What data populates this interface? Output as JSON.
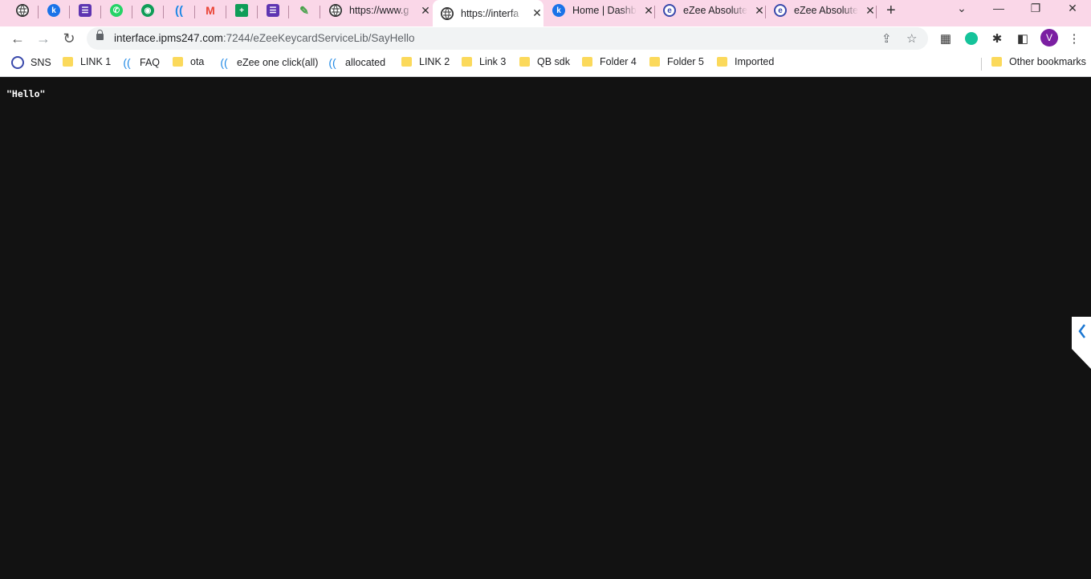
{
  "tabs": [
    {
      "title": "",
      "favicon": "globe-icon",
      "color": "#333333"
    },
    {
      "title": "",
      "favicon": "k-icon",
      "color": "#1a73e8"
    },
    {
      "title": "",
      "favicon": "list-icon",
      "color": "#5e35b1"
    },
    {
      "title": "",
      "favicon": "whatsapp-icon",
      "color": "#25d366"
    },
    {
      "title": "",
      "favicon": "circle-icon",
      "color": "#0f9d58"
    },
    {
      "title": "",
      "favicon": "ezee-c-icon",
      "color": "#1e88e5"
    },
    {
      "title": "",
      "favicon": "gmail-icon",
      "color": "#ea4335"
    },
    {
      "title": "",
      "favicon": "sheets-icon",
      "color": "#0f9d58"
    },
    {
      "title": "",
      "favicon": "list-icon",
      "color": "#5e35b1"
    },
    {
      "title": "",
      "favicon": "feather-icon",
      "color": "#43a047"
    },
    {
      "title": "https://www.g",
      "favicon": "globe-icon",
      "color": "#333333"
    },
    {
      "title": "https://interfa",
      "favicon": "globe-icon",
      "color": "#333333",
      "active": true
    },
    {
      "title": "Home | Dashb",
      "favicon": "k-icon",
      "color": "#1a73e8"
    },
    {
      "title": "eZee Absolute",
      "favicon": "ezee-icon",
      "color": "#3949ab"
    },
    {
      "title": "eZee Absolute",
      "favicon": "ezee-icon",
      "color": "#3949ab"
    }
  ],
  "address": {
    "host": "interface.ipms247.com",
    "path": ":7244/eZeeKeycardServiceLib/SayHello"
  },
  "avatar_letter": "V",
  "bookmarks": [
    {
      "label": "SNS",
      "icon": "sns-icon"
    },
    {
      "label": "LINK 1",
      "icon": "folder-icon"
    },
    {
      "label": "FAQ",
      "icon": "ezee-c-icon"
    },
    {
      "label": "ota",
      "icon": "folder-icon"
    },
    {
      "label": "eZee one click(all)",
      "icon": "ezee-c-icon"
    },
    {
      "label": "allocated",
      "icon": "ezee-c-icon"
    },
    {
      "label": "LINK 2",
      "icon": "folder-icon"
    },
    {
      "label": "Link 3",
      "icon": "folder-icon"
    },
    {
      "label": "QB sdk",
      "icon": "folder-icon"
    },
    {
      "label": "Folder 4",
      "icon": "folder-icon"
    },
    {
      "label": "Folder 5",
      "icon": "folder-icon"
    },
    {
      "label": "Imported",
      "icon": "folder-icon"
    }
  ],
  "other_bookmarks": "Other bookmarks",
  "response_text": "\"Hello\""
}
